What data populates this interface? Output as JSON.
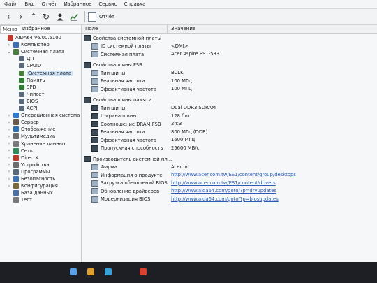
{
  "menu": [
    "Файл",
    "Вид",
    "Отчёт",
    "Избранное",
    "Сервис",
    "Справка"
  ],
  "toolbar": {
    "report_label": "Отчёт",
    "icons": [
      "back-icon",
      "forward-icon",
      "up-icon",
      "refresh-icon",
      "user-icon",
      "chart-icon"
    ]
  },
  "left": {
    "tabs": [
      "Меню",
      "Избранное"
    ],
    "tree": [
      {
        "label": "AIDA64 v6.00.5100",
        "level": 0,
        "exp": "",
        "color": "#c0392b"
      },
      {
        "label": "Компьютер",
        "level": 1,
        "exp": "›",
        "color": "#3b6fb6"
      },
      {
        "label": "Системная плата",
        "level": 1,
        "exp": "⌄",
        "color": "#4a7f3f"
      },
      {
        "label": "ЦП",
        "level": 2,
        "exp": "",
        "color": "#5a6a7a"
      },
      {
        "label": "CPUID",
        "level": 2,
        "exp": "",
        "color": "#5a6a7a"
      },
      {
        "label": "Системная плата",
        "level": 2,
        "exp": "",
        "color": "#4a7f3f",
        "selected": true
      },
      {
        "label": "Память",
        "level": 2,
        "exp": "",
        "color": "#2f7d32"
      },
      {
        "label": "SPD",
        "level": 2,
        "exp": "",
        "color": "#2f7d32"
      },
      {
        "label": "Чипсет",
        "level": 2,
        "exp": "",
        "color": "#5a6a7a"
      },
      {
        "label": "BIOS",
        "level": 2,
        "exp": "",
        "color": "#5a6a7a"
      },
      {
        "label": "ACPI",
        "level": 2,
        "exp": "",
        "color": "#5a6a7a"
      },
      {
        "label": "Операционная система",
        "level": 1,
        "exp": "›",
        "color": "#2b7bd1"
      },
      {
        "label": "Сервер",
        "level": 1,
        "exp": "›",
        "color": "#6d5b4a"
      },
      {
        "label": "Отображение",
        "level": 1,
        "exp": "›",
        "color": "#2f6fb0"
      },
      {
        "label": "Мультимедиа",
        "level": 1,
        "exp": "›",
        "color": "#6a6a6a"
      },
      {
        "label": "Хранение данных",
        "level": 1,
        "exp": "›",
        "color": "#7a7a7a"
      },
      {
        "label": "Сеть",
        "level": 1,
        "exp": "›",
        "color": "#2f8a5a"
      },
      {
        "label": "DirectX",
        "level": 1,
        "exp": "›",
        "color": "#c0392b"
      },
      {
        "label": "Устройства",
        "level": 1,
        "exp": "›",
        "color": "#6a6a6a"
      },
      {
        "label": "Программы",
        "level": 1,
        "exp": "›",
        "color": "#5a6a7a"
      },
      {
        "label": "Безопасность",
        "level": 1,
        "exp": "›",
        "color": "#3b6fb6"
      },
      {
        "label": "Конфигурация",
        "level": 1,
        "exp": "›",
        "color": "#7a6a3a"
      },
      {
        "label": "База данных",
        "level": 1,
        "exp": "",
        "color": "#4a6fa5"
      },
      {
        "label": "Тест",
        "level": 1,
        "exp": "",
        "color": "#7a7a7a"
      }
    ]
  },
  "right": {
    "col_field": "Поле",
    "col_value": "Значение",
    "rows": [
      {
        "type": "group",
        "label": "Свойства системной платы",
        "value": ""
      },
      {
        "type": "item",
        "label": "ID системной платы",
        "value": "<DMI>",
        "icon": "lt"
      },
      {
        "type": "item",
        "label": "Системная плата",
        "value": "Acer Aspire ES1-533",
        "icon": "lt"
      },
      {
        "type": "spacer"
      },
      {
        "type": "group",
        "label": "Свойства шины FSB",
        "value": ""
      },
      {
        "type": "item",
        "label": "Тип шины",
        "value": "BCLK",
        "icon": "lt"
      },
      {
        "type": "item",
        "label": "Реальная частота",
        "value": "100 МГц",
        "icon": "lt"
      },
      {
        "type": "item",
        "label": "Эффективная частота",
        "value": "100 МГц",
        "icon": "lt"
      },
      {
        "type": "spacer"
      },
      {
        "type": "group",
        "label": "Свойства шины памяти",
        "value": ""
      },
      {
        "type": "item",
        "label": "Тип шины",
        "value": "Dual DDR3 SDRAM",
        "icon": "dk"
      },
      {
        "type": "item",
        "label": "Ширина шины",
        "value": "128 бит",
        "icon": "dk"
      },
      {
        "type": "item",
        "label": "Соотношение DRAM:FSB",
        "value": "24:3",
        "icon": "dk"
      },
      {
        "type": "item",
        "label": "Реальная частота",
        "value": "800 МГц (DDR)",
        "icon": "dk"
      },
      {
        "type": "item",
        "label": "Эффективная частота",
        "value": "1600 МГц",
        "icon": "dk"
      },
      {
        "type": "item",
        "label": "Пропускная способность",
        "value": "25600 МБ/с",
        "icon": "dk"
      },
      {
        "type": "spacer"
      },
      {
        "type": "group",
        "label": "Производитель системной пл...",
        "value": ""
      },
      {
        "type": "item",
        "label": "Фирма",
        "value": "Acer Inc.",
        "icon": "lt"
      },
      {
        "type": "item",
        "label": "Информация о продукте",
        "value": "http://www.acer.com.tw/ES1/content/group/desktops",
        "icon": "lt",
        "link": true
      },
      {
        "type": "item",
        "label": "Загрузка обновлений BIOS",
        "value": "http://www.acer.com.tw/ES1/content/drivers",
        "icon": "lt",
        "link": true
      },
      {
        "type": "item",
        "label": "Обновление драйверов",
        "value": "http://www.aida64.com/goto/?p=drvupdates",
        "icon": "lt",
        "link": true
      },
      {
        "type": "item",
        "label": "Модернизация BIOS",
        "value": "http://www.aida64.com/goto/?p=biosupdates",
        "icon": "lt",
        "link": true
      }
    ]
  }
}
